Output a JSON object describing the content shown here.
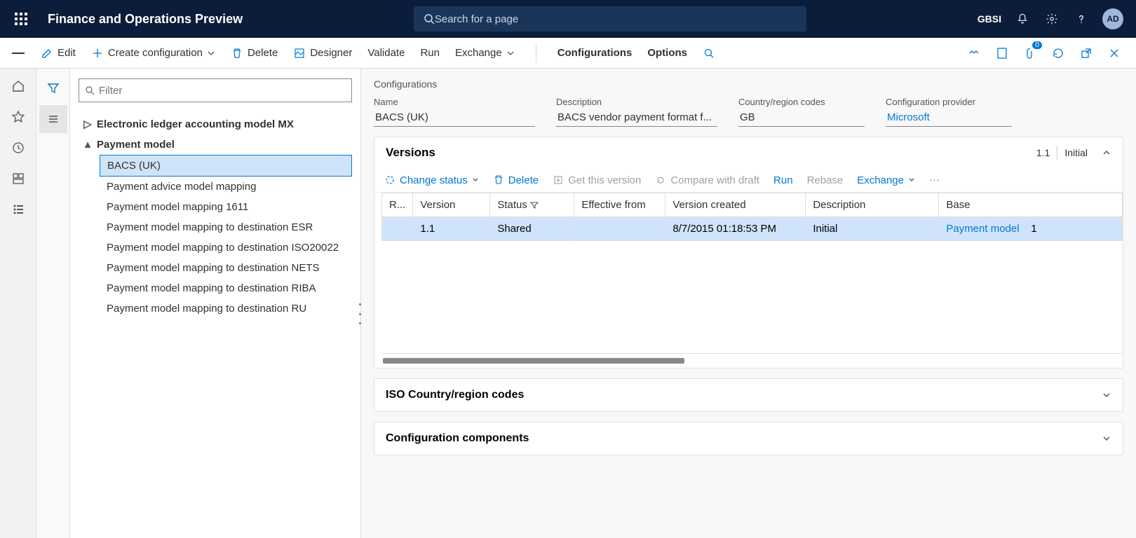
{
  "header": {
    "app_title": "Finance and Operations Preview",
    "search_placeholder": "Search for a page",
    "entity": "GBSI",
    "avatar": "AD"
  },
  "toolbar": {
    "edit": "Edit",
    "create_config": "Create configuration",
    "delete": "Delete",
    "designer": "Designer",
    "validate": "Validate",
    "run": "Run",
    "exchange": "Exchange",
    "configurations": "Configurations",
    "options": "Options",
    "attach_badge": "0"
  },
  "filter": {
    "placeholder": "Filter"
  },
  "tree": {
    "root1": "Electronic ledger accounting model MX",
    "root2": "Payment model",
    "children": [
      "BACS (UK)",
      "Payment advice model mapping",
      "Payment model mapping 1611",
      "Payment model mapping to destination ESR",
      "Payment model mapping to destination ISO20022",
      "Payment model mapping to destination NETS",
      "Payment model mapping to destination RIBA",
      "Payment model mapping to destination RU"
    ]
  },
  "breadcrumb": "Configurations",
  "fields": {
    "name_lbl": "Name",
    "name_val": "BACS (UK)",
    "desc_lbl": "Description",
    "desc_val": "BACS vendor payment format f...",
    "cc_lbl": "Country/region codes",
    "cc_val": "GB",
    "prov_lbl": "Configuration provider",
    "prov_val": "Microsoft"
  },
  "versions": {
    "title": "Versions",
    "meta_ver": "1.1",
    "meta_status": "Initial",
    "toolbar": {
      "change_status": "Change status",
      "delete": "Delete",
      "get_version": "Get this version",
      "compare": "Compare with draft",
      "run": "Run",
      "rebase": "Rebase",
      "exchange": "Exchange"
    },
    "columns": {
      "r": "R...",
      "version": "Version",
      "status": "Status",
      "effective": "Effective from",
      "created": "Version created",
      "description": "Description",
      "base": "Base"
    },
    "row": {
      "version": "1.1",
      "status": "Shared",
      "effective": "",
      "created": "8/7/2015 01:18:53 PM",
      "description": "Initial",
      "base": "Payment model",
      "base_ver": "1"
    }
  },
  "sections": {
    "iso": "ISO Country/region codes",
    "components": "Configuration components"
  }
}
